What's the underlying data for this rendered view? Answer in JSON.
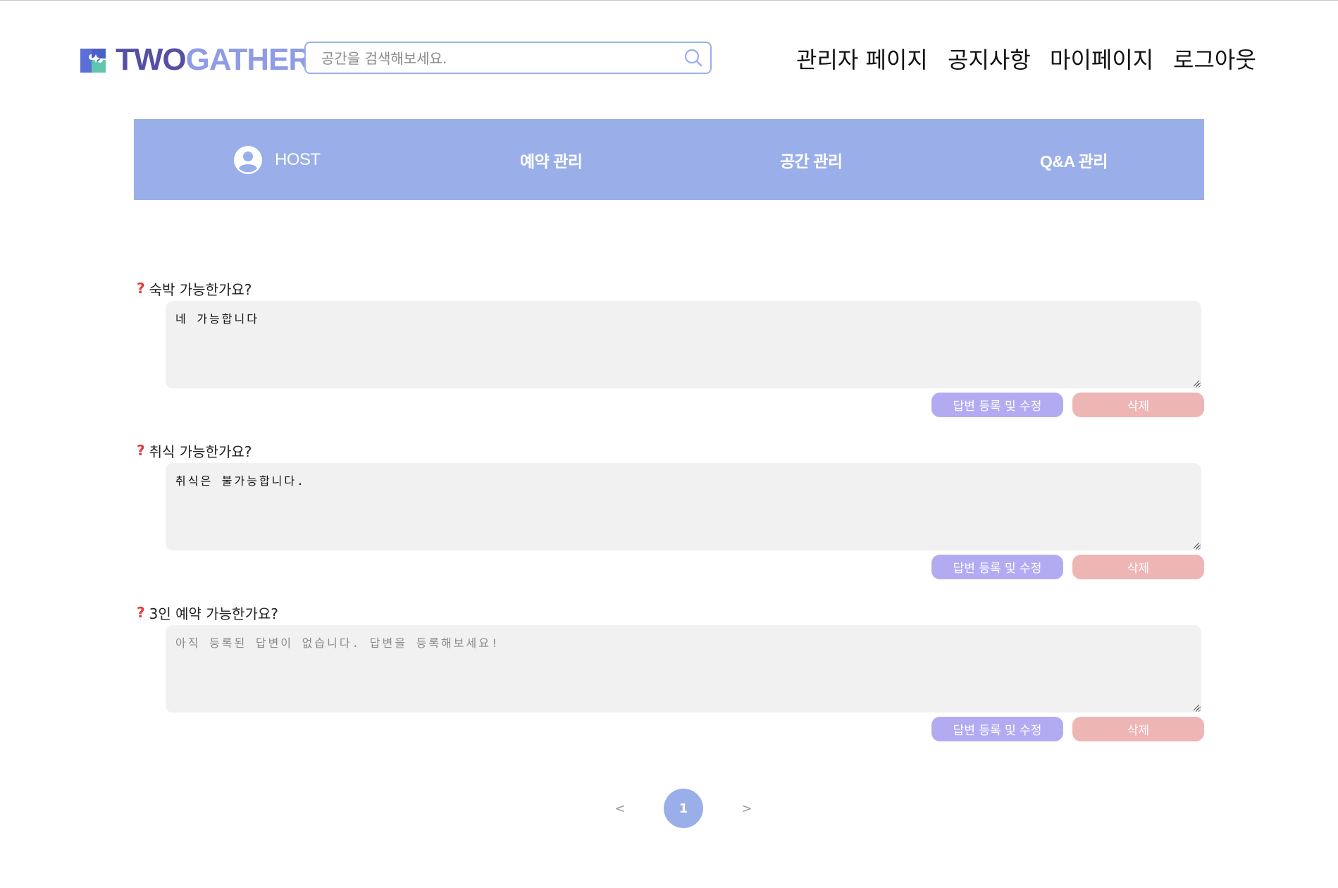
{
  "brand": {
    "name_part1": "TWO",
    "name_part2": "GATHER",
    "colors": {
      "dark": "#5550a3",
      "light": "#8e9ce6"
    }
  },
  "search": {
    "placeholder": "공간을 검색해보세요.",
    "value": "",
    "icon": "search-icon"
  },
  "nav": {
    "items": [
      {
        "label": "관리자 페이지"
      },
      {
        "label": "공지사항"
      },
      {
        "label": "마이페이지"
      },
      {
        "label": "로그아웃"
      }
    ]
  },
  "host_menu": {
    "background": "#9aaeea",
    "host_label": "HOST",
    "host_icon": "user-circle-icon",
    "items": [
      {
        "label": "예약 관리"
      },
      {
        "label": "공간 관리"
      },
      {
        "label": "Q&A 관리"
      }
    ]
  },
  "qa": [
    {
      "question": "숙박 가능한가요?",
      "answer": "네 가능합니다",
      "placeholder": ""
    },
    {
      "question": "취식 가능한가요?",
      "answer": "취식은 불가능합니다.",
      "placeholder": ""
    },
    {
      "question": "3인 예약 가능한가요?",
      "answer": "",
      "placeholder": "아직 등록된 답변이 없습니다. 답변을 등록해보세요!"
    }
  ],
  "qa_buttons": {
    "edit_label": "답변 등록 및 수정",
    "delete_label": "삭제",
    "edit_color": "#b3abf2",
    "delete_color": "#eeb5b5"
  },
  "question_mark": "?",
  "pagination": {
    "prev": "<",
    "current": "1",
    "next": ">"
  }
}
